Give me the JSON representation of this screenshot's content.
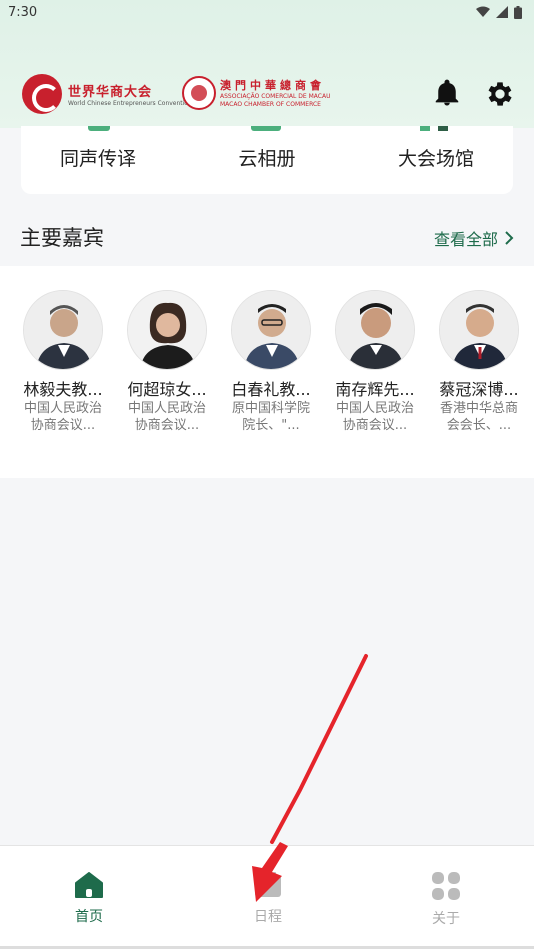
{
  "status_bar": {
    "time": "7:30"
  },
  "header": {
    "logo1": {
      "cn": "世界华商大会",
      "en": "World Chinese Entrepreneurs Convention"
    },
    "logo2": {
      "cn": "澳門中華總商會",
      "en1": "ASSOCIAÇÃO COMERCIAL DE MACAU",
      "en2": "MACAO CHAMBER OF COMMERCE"
    }
  },
  "menu": {
    "items": [
      {
        "label": "同声传译"
      },
      {
        "label": "云相册"
      },
      {
        "label": "大会场馆"
      }
    ]
  },
  "guests_section": {
    "title": "主要嘉宾",
    "view_all": "查看全部",
    "guests": [
      {
        "name": "林毅夫教...",
        "desc": "中国人民政治协商会议..."
      },
      {
        "name": "何超琼女...",
        "desc": "中国人民政治协商会议..."
      },
      {
        "name": "白春礼教...",
        "desc": "原中国科学院院长、\"..."
      },
      {
        "name": "南存辉先...",
        "desc": "中国人民政治协商会议..."
      },
      {
        "name": "蔡冠深博...",
        "desc": "香港中华总商会会长、..."
      }
    ]
  },
  "tabbar": {
    "tabs": [
      {
        "label": "首页",
        "icon": "home-icon",
        "active": true
      },
      {
        "label": "日程",
        "icon": "calendar-icon",
        "active": false
      },
      {
        "label": "关于",
        "icon": "grid-icon",
        "active": false
      }
    ]
  },
  "colors": {
    "accent": "#1e6b4b",
    "brand_red": "#c8202d",
    "annotation_arrow": "#e5242b"
  }
}
